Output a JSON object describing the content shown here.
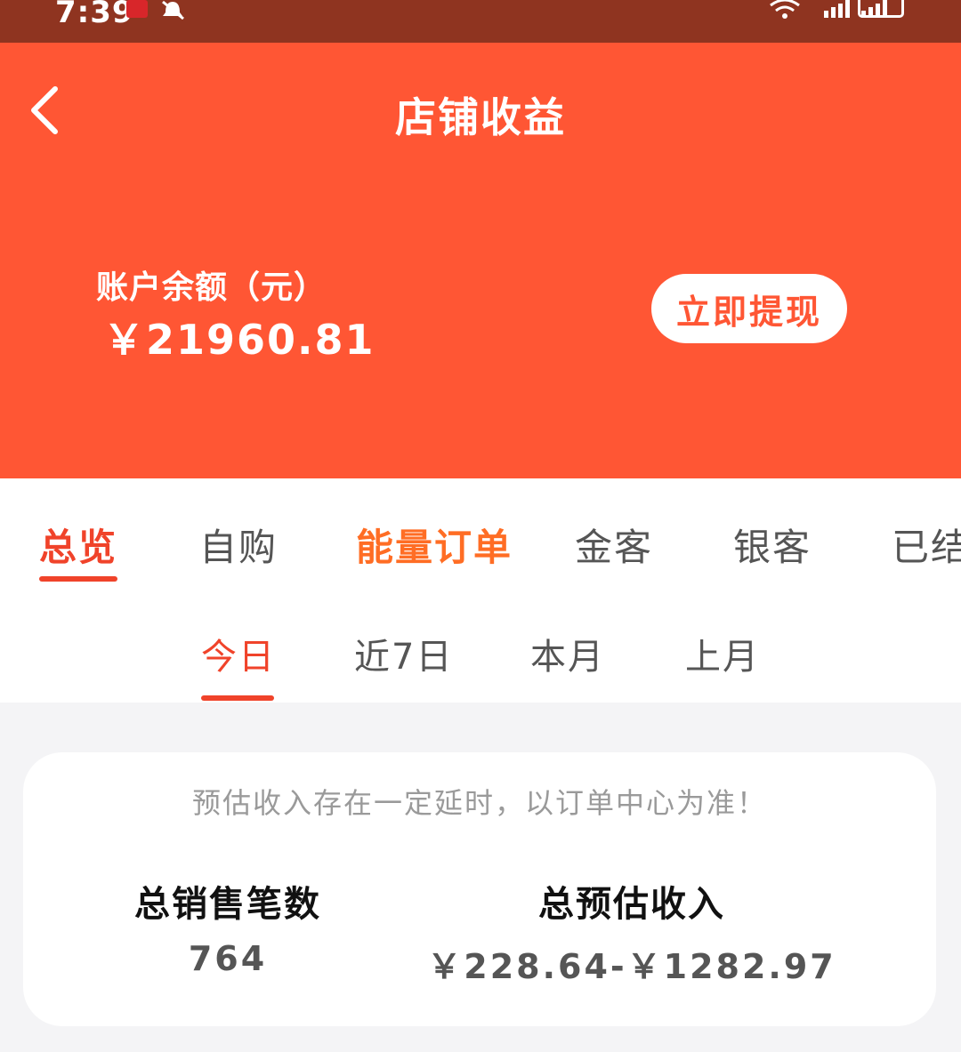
{
  "status_bar": {
    "time": "7:39",
    "icons": [
      "app-badge-icon",
      "mute-bell-icon",
      "wifi-icon",
      "signal-icon",
      "signal-icon",
      "battery-icon"
    ]
  },
  "header": {
    "title": "店铺收益",
    "back_icon": "chevron-left-icon"
  },
  "balance": {
    "label": "账户余额（元）",
    "amount": "￥21960.81",
    "withdraw_label": "立即提现"
  },
  "main_tabs": [
    {
      "label": "总览",
      "active": true
    },
    {
      "label": "自购"
    },
    {
      "label": "能量订单"
    },
    {
      "label": "金客"
    },
    {
      "label": "银客"
    },
    {
      "label": "已结"
    }
  ],
  "sub_tabs": [
    {
      "label": "今日",
      "active": true
    },
    {
      "label": "近7日"
    },
    {
      "label": "本月"
    },
    {
      "label": "上月"
    }
  ],
  "summary": {
    "notice": "预估收入存在一定延时，以订单中心为准！",
    "total_sales_label": "总销售笔数",
    "total_sales_value": "764",
    "total_income_label": "总预估收入",
    "total_income_value": "￥228.64-￥1282.97"
  },
  "colors": {
    "status_bar": "#8f3420",
    "primary": "#ff5634",
    "active_tab": "#f0432a",
    "energy_tab": "#ff6d24"
  }
}
